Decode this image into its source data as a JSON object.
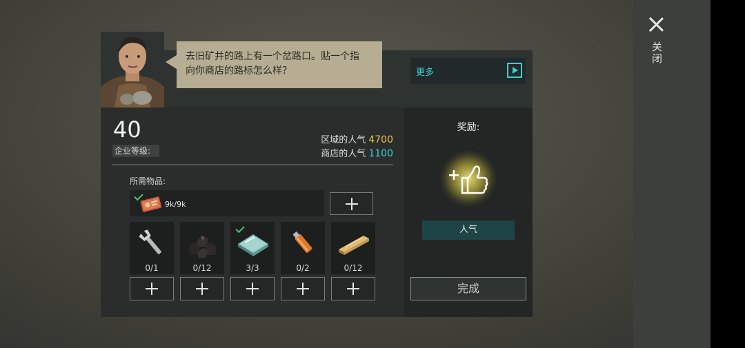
{
  "dialog": {
    "speech_line1": "去旧矿井的路上有一个岔路口。贴一个指",
    "speech_line2": "向你商店的路标怎么样？",
    "more_label": "更多"
  },
  "close": {
    "label": "关闭"
  },
  "company": {
    "level": "40",
    "level_label": "企业等级:"
  },
  "popularity": {
    "region_label": "区域的人气",
    "region_value": "4700",
    "shop_label": "商店的人气",
    "shop_value": "1100"
  },
  "requirements": {
    "title": "所需物品:",
    "voucher": {
      "count": "9k/9k",
      "completed": true
    },
    "slots": [
      {
        "icon": "wrench-icon",
        "count": "0/1",
        "completed": false
      },
      {
        "icon": "coal-icon",
        "count": "0/12",
        "completed": false
      },
      {
        "icon": "glass-icon",
        "count": "3/3",
        "completed": true
      },
      {
        "icon": "battery-icon",
        "count": "0/2",
        "completed": false
      },
      {
        "icon": "plank-icon",
        "count": "0/12",
        "completed": false
      }
    ]
  },
  "reward": {
    "title": "奖励:",
    "icon": "thumbs-up-plus-icon",
    "label": "人气"
  },
  "actions": {
    "complete_label": "完成"
  },
  "colors": {
    "accent_cyan": "#3fcfd6",
    "accent_yellow": "#e6c34c",
    "check_green": "#48c76a",
    "speech_bg": "#b6ad93"
  }
}
